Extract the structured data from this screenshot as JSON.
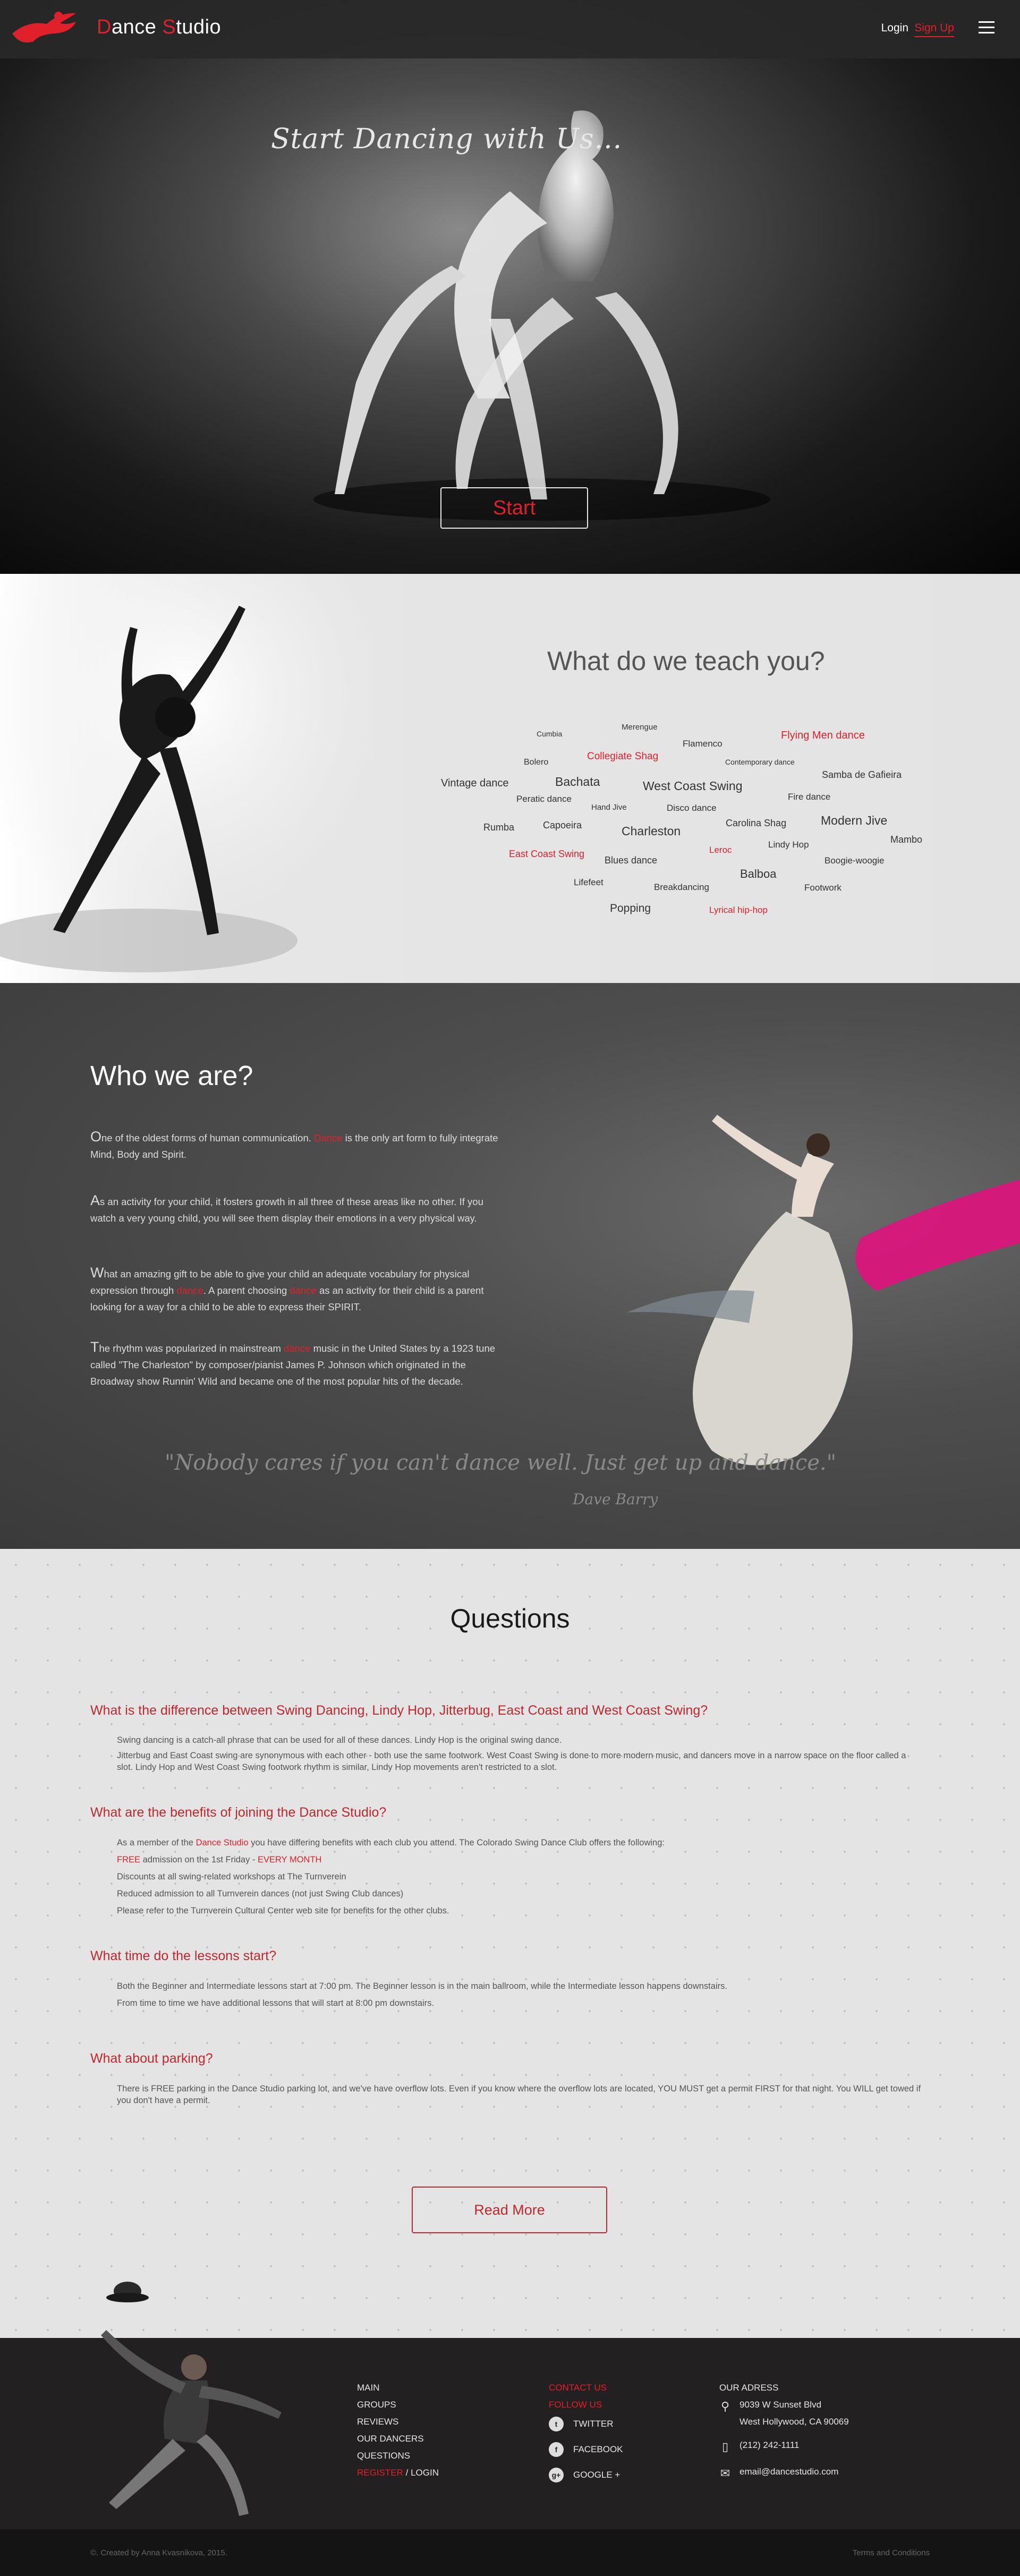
{
  "header": {
    "brand_first_initial": "D",
    "brand_first_rest": "ance ",
    "brand_second_initial": "S",
    "brand_second_rest": "tudio",
    "login_label": "Login",
    "signup_label": "Sign Up",
    "menu_icon": "hamburger-icon"
  },
  "hero": {
    "title": "Start Dancing with Us...",
    "start_label": "Start"
  },
  "teach": {
    "title": "What do we teach you?",
    "tags": [
      {
        "label": "Cumbia",
        "red": false
      },
      {
        "label": "Merengue",
        "red": false
      },
      {
        "label": "Flamenco",
        "red": false
      },
      {
        "label": "Flying Men dance",
        "red": true
      },
      {
        "label": "Bolero",
        "red": false
      },
      {
        "label": "Collegiate Shag",
        "red": true
      },
      {
        "label": "Contemporary dance",
        "red": false
      },
      {
        "label": "Samba de Gafieira",
        "red": false
      },
      {
        "label": "Vintage dance",
        "red": false
      },
      {
        "label": "Bachata",
        "red": false
      },
      {
        "label": "West Coast Swing",
        "red": false
      },
      {
        "label": "Fire dance",
        "red": false
      },
      {
        "label": "Peratic dance",
        "red": false
      },
      {
        "label": "Hand Jive",
        "red": false
      },
      {
        "label": "Disco dance",
        "red": false
      },
      {
        "label": "Modern Jive",
        "red": false
      },
      {
        "label": "Carolina Shag",
        "red": false
      },
      {
        "label": "Rumba",
        "red": false
      },
      {
        "label": "Capoeira",
        "red": false
      },
      {
        "label": "Charleston",
        "red": false
      },
      {
        "label": "Mambo",
        "red": false
      },
      {
        "label": "Lindy Hop",
        "red": false
      },
      {
        "label": "East Coast Swing",
        "red": true
      },
      {
        "label": "Leroc",
        "red": true
      },
      {
        "label": "Blues dance",
        "red": false
      },
      {
        "label": "Boogie-woogie",
        "red": false
      },
      {
        "label": "Balboa",
        "red": false
      },
      {
        "label": "Lifefeet",
        "red": false
      },
      {
        "label": "Breakdancing",
        "red": false
      },
      {
        "label": "Footwork",
        "red": false
      },
      {
        "label": "Popping",
        "red": false
      },
      {
        "label": "Lyrical hip-hop",
        "red": true
      }
    ]
  },
  "who": {
    "title": "Who we are?",
    "p1": {
      "cap": "O",
      "a": "ne of the oldest forms of human communication. ",
      "red": "Dance",
      "b": " is the only art form to fully integrate Mind, Body and Spirit."
    },
    "p2": {
      "cap": "A",
      "a": "s an activity for your child, it fosters growth in all three of these areas like no other. If you watch a very young child, you will see them display their emotions in a very physical way."
    },
    "p3": {
      "cap": "W",
      "a": "hat an amazing gift to be able to give your child an adequate vocabulary for physical expression through ",
      "red": "dance",
      "b": ". A parent choosing ",
      "red2": "dance",
      "c": " as an activity for their child is a parent looking for a way for a child to be able to express their SPIRIT."
    },
    "p4": {
      "cap": "T",
      "a": "he rhythm was popularized in mainstream ",
      "red": "dance",
      "b": " music in the United States by a 1923 tune called \"The Charleston\" by composer/pianist James P. Johnson which originated in the Broadway show Runnin' Wild and became one of the most popular hits of the decade."
    },
    "quote": "\"Nobody cares if you can't dance well. Just get up and dance.\"",
    "author": "Dave Barry"
  },
  "questions": {
    "title": "Questions",
    "q1": {
      "head": "What is the difference between Swing Dancing, Lindy Hop, Jitterbug, East Coast and West Coast Swing?",
      "l1": "Swing dancing is a catch-all phrase that can be used for all of these dances. Lindy Hop is the original swing dance.",
      "l2": "Jitterbug and East Coast swing are synonymous with each other - both use the same footwork. West Coast Swing is done to more modern music, and dancers move in a narrow space on the floor called a slot. Lindy Hop and West Coast Swing footwork rhythm is similar, Lindy Hop movements aren't restricted to a slot."
    },
    "q2": {
      "head": "What are the benefits of joining the Dance Studio?",
      "l1a": "As a member of the ",
      "l1red": "Dance Studio",
      "l1b": " you have differing benefits with each club you attend. The Colorado Swing Dance Club offers the following:",
      "l2red1": "FREE",
      "l2mid": " admission on the 1st Friday - ",
      "l2red2": "EVERY MONTH",
      "l3": "Discounts at all swing-related workshops at The Turnverein",
      "l4": "Reduced admission to all Turnverein dances (not just Swing Club dances)",
      "l5": "Please refer to the Turnverein Cultural Center web site for benefits for the other clubs."
    },
    "q3": {
      "head": "What time do the lessons start?",
      "l1": "Both the Beginner and Intermediate lessons start at 7:00 pm. The Beginner lesson is in the main ballroom, while the Intermediate lesson happens downstairs.",
      "l2": "From time to time we have additional lessons that will start at 8:00 pm downstairs."
    },
    "q4": {
      "head": "What about parking?",
      "l1": "There is FREE parking in the Dance Studio parking lot, and we've have overflow lots. Even if you know where the overflow lots are located, YOU MUST get a permit FIRST for that night. You WILL get towed if you don't have a permit."
    },
    "read_more": "Read More"
  },
  "footer": {
    "nav": [
      "MAIN",
      "GROUPS",
      "REVIEWS",
      "OUR DANCERS",
      "QUESTIONS"
    ],
    "register": "REGISTER",
    "sep": " / ",
    "login": "LOGIN",
    "contact_us": "CONTACT US",
    "follow_us": "FOLLOW US",
    "twitter": "TWITTER",
    "facebook": "FACEBOOK",
    "google": "GOOGLE +",
    "address_title": "OUR ADRESS",
    "address_line1": "9039 W Sunset Blvd",
    "address_line2": "West Hollywood, CA 90069",
    "phone": "(212) 242-1111",
    "email": "email@dancestudio.com",
    "copyright": "©. Created by Anna Kvasnikova, 2015.",
    "terms": "Terms and Conditions"
  },
  "colors": {
    "accent": "#e0202a",
    "dark": "#222021",
    "light_bg": "#e4e4e4"
  }
}
